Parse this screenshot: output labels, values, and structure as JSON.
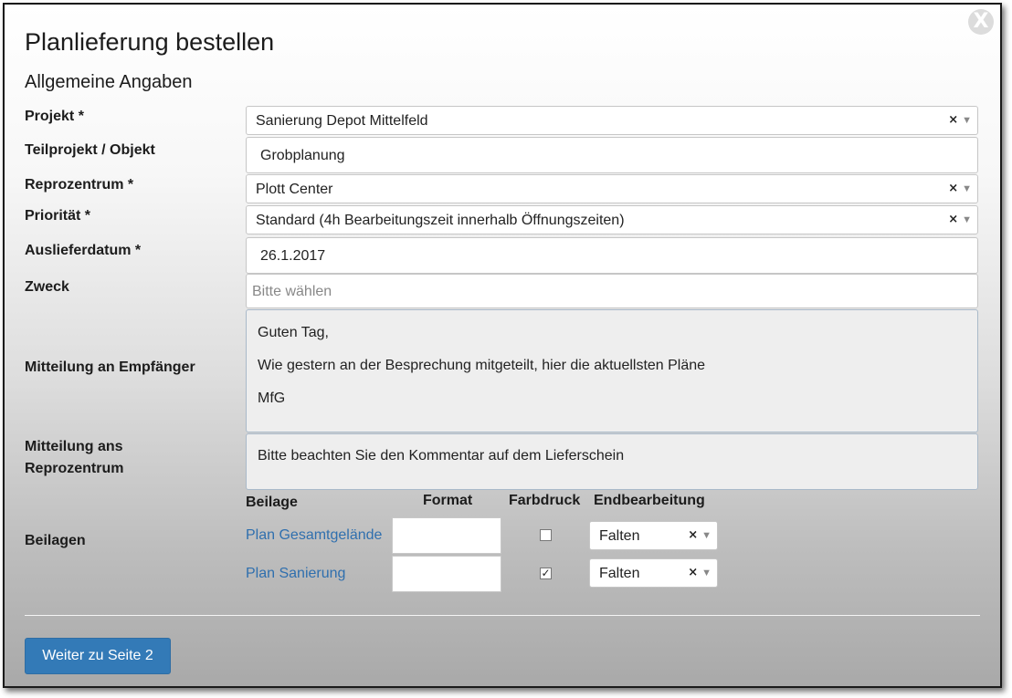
{
  "dialog": {
    "title": "Planlieferung bestellen",
    "close_label": "X",
    "section_title": "Allgemeine Angaben"
  },
  "fields": {
    "projekt": {
      "label": "Projekt *",
      "value": "Sanierung Depot Mittelfeld",
      "clear": "×",
      "arrow": "▼"
    },
    "teilprojekt": {
      "label": "Teilprojekt / Objekt",
      "value": "Grobplanung"
    },
    "reprozentrum": {
      "label": "Reprozentrum *",
      "value": "Plott Center",
      "clear": "×",
      "arrow": "▼"
    },
    "prioritaet": {
      "label": "Priorität *",
      "value": "Standard (4h Bearbeitungszeit innerhalb Öffnungszeiten)",
      "clear": "×",
      "arrow": "▼"
    },
    "auslieferdatum": {
      "label": "Auslieferdatum *",
      "value": "26.1.2017"
    },
    "zweck": {
      "label": "Zweck",
      "placeholder": "Bitte wählen"
    },
    "mitteilung_empfaenger": {
      "label": "Mitteilung an Empfänger",
      "lines": [
        "Guten Tag,",
        "Wie gestern an der Besprechung mitgeteilt, hier die aktuellsten Pläne",
        "MfG"
      ]
    },
    "mitteilung_repro": {
      "label_line1": "Mitteilung ans",
      "label_line2": "Reprozentrum",
      "text": "Bitte beachten Sie den Kommentar auf dem Lieferschein"
    }
  },
  "beilagen": {
    "label": "Beilagen",
    "headers": {
      "beilage": "Beilage",
      "format": "Format",
      "farbdruck": "Farbdruck",
      "endbearbeitung": "Endbearbeitung"
    },
    "rows": [
      {
        "name": "Plan Gesamtgelände",
        "format": "",
        "farbdruck": false,
        "farbdruck_mark": "",
        "endbearbeitung": "Falten",
        "clear": "×",
        "arrow": "▼"
      },
      {
        "name": "Plan Sanierung",
        "format": "",
        "farbdruck": true,
        "farbdruck_mark": "✓",
        "endbearbeitung": "Falten",
        "clear": "×",
        "arrow": "▼"
      }
    ]
  },
  "footer": {
    "next_button": "Weiter zu Seite 2"
  },
  "colors": {
    "primary": "#337ab7",
    "link": "#2f6fae"
  }
}
